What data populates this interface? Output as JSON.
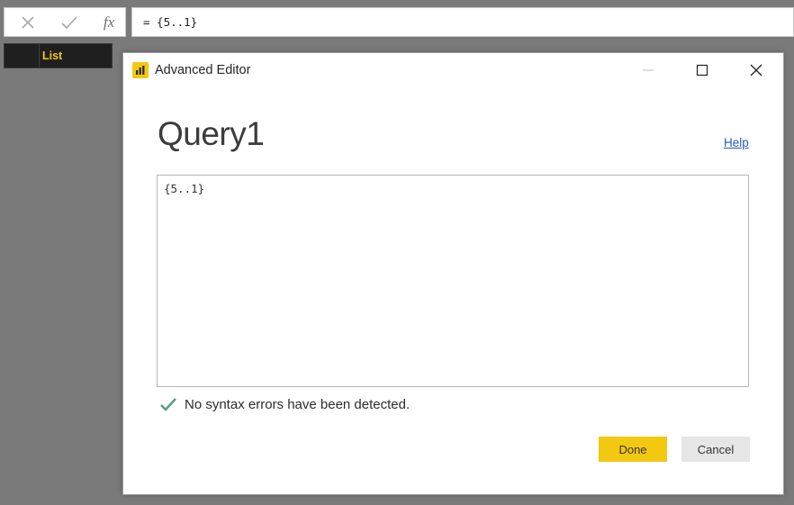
{
  "formula_bar": {
    "cancel_icon": "x-icon",
    "commit_icon": "check-icon",
    "fx_label": "fx",
    "formula": "= {5..1}"
  },
  "column_header": {
    "label": "List"
  },
  "dialog": {
    "title": "Advanced Editor",
    "app_icon": "power-bi-icon",
    "query_name": "Query1",
    "help_label": "Help",
    "code": "{5..1}",
    "status_text": "No syntax errors have been detected.",
    "done_label": "Done",
    "cancel_label": "Cancel"
  },
  "colors": {
    "accent": "#f2c811",
    "status_check": "#5a9f86",
    "link": "#1f5fbf",
    "backdrop": "#7a7a7a"
  }
}
